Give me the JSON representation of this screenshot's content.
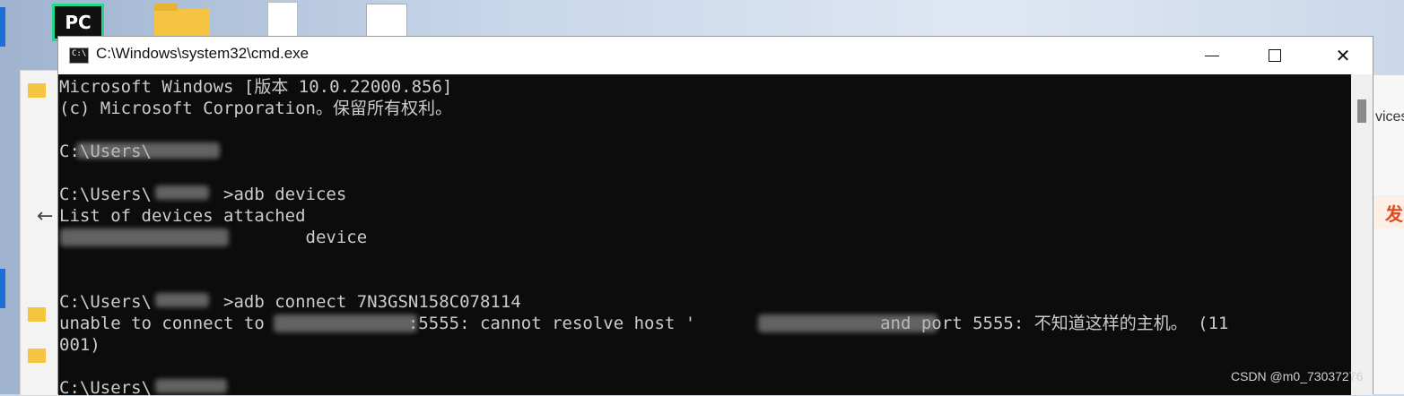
{
  "desktop": {
    "icons": [
      "pycharm-icon",
      "folder-icon",
      "document-icon",
      "document-icon"
    ],
    "pycharm_label": "PC"
  },
  "console": {
    "title": "C:\\Windows\\system32\\cmd.exe",
    "lines": [
      "Microsoft Windows [版本 10.0.22000.856]",
      "(c) Microsoft Corporation。保留所有权利。",
      "",
      "C:\\Users\\",
      "",
      "C:\\Users\\       >adb devices",
      "List of devices attached",
      "                        device",
      "",
      "",
      "C:\\Users\\       >adb connect 7N3GSN158C078114",
      "unable to connect to              :5555: cannot resolve host '                  and port 5555: 不知道这样的主机。 (11",
      "001)",
      "",
      "C:\\Users\\"
    ],
    "colors": {
      "background": "#0c0c0c",
      "text": "#cccccc"
    }
  },
  "background_windows": {
    "right_peek_text": "vices",
    "right_ad_text": "发"
  },
  "watermark": "CSDN @m0_73037276"
}
